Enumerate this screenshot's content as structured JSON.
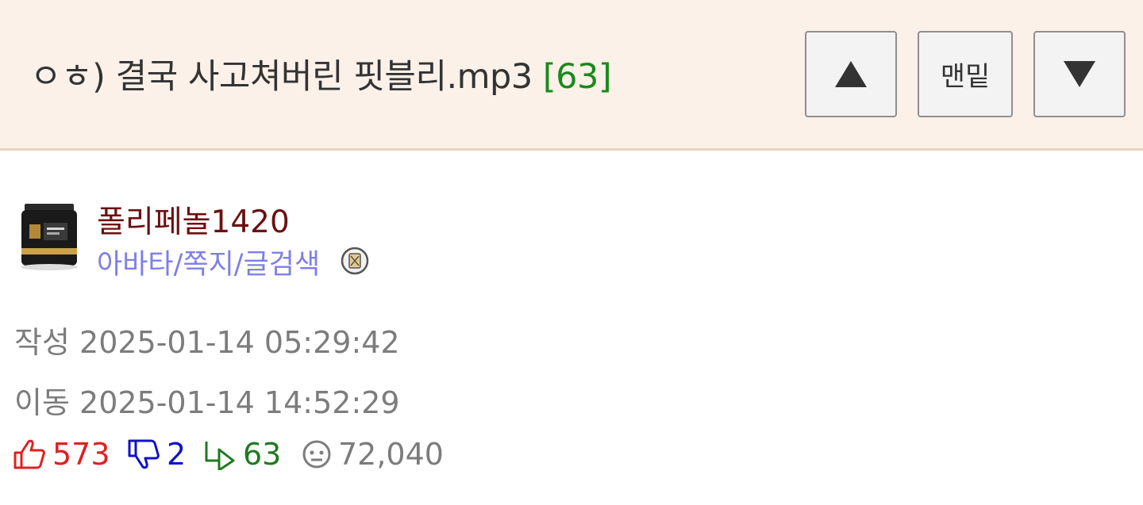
{
  "header": {
    "title": "ㅇㅎ) 결국 사고쳐버린 핏블리.mp3",
    "comment_count": "[63]",
    "buttons": {
      "up_icon": "triangle-up-icon",
      "bottom_label": "맨밑",
      "down_icon": "triangle-down-icon"
    }
  },
  "author": {
    "avatar_icon": "product-jar-avatar",
    "name": "폴리페놀1420",
    "links": "아바타/쪽지/글검색",
    "badge_icon": "grade-badge-icon"
  },
  "meta": {
    "created_label": "작성",
    "created": "2025-01-14 05:29:42",
    "moved_label": "이동",
    "moved": "2025-01-14 14:52:29"
  },
  "stats": {
    "likes": "573",
    "dislikes": "2",
    "replies": "63",
    "views": "72,040"
  },
  "colors": {
    "header_bg": "#fbf1e9",
    "comment_count": "#1a8a1a",
    "author_name": "#6b1010",
    "author_links": "#7f7fe6",
    "likes": "#e02020",
    "dislikes": "#1010cc",
    "replies": "#1f7a1f",
    "meta": "#7c7c7c"
  }
}
